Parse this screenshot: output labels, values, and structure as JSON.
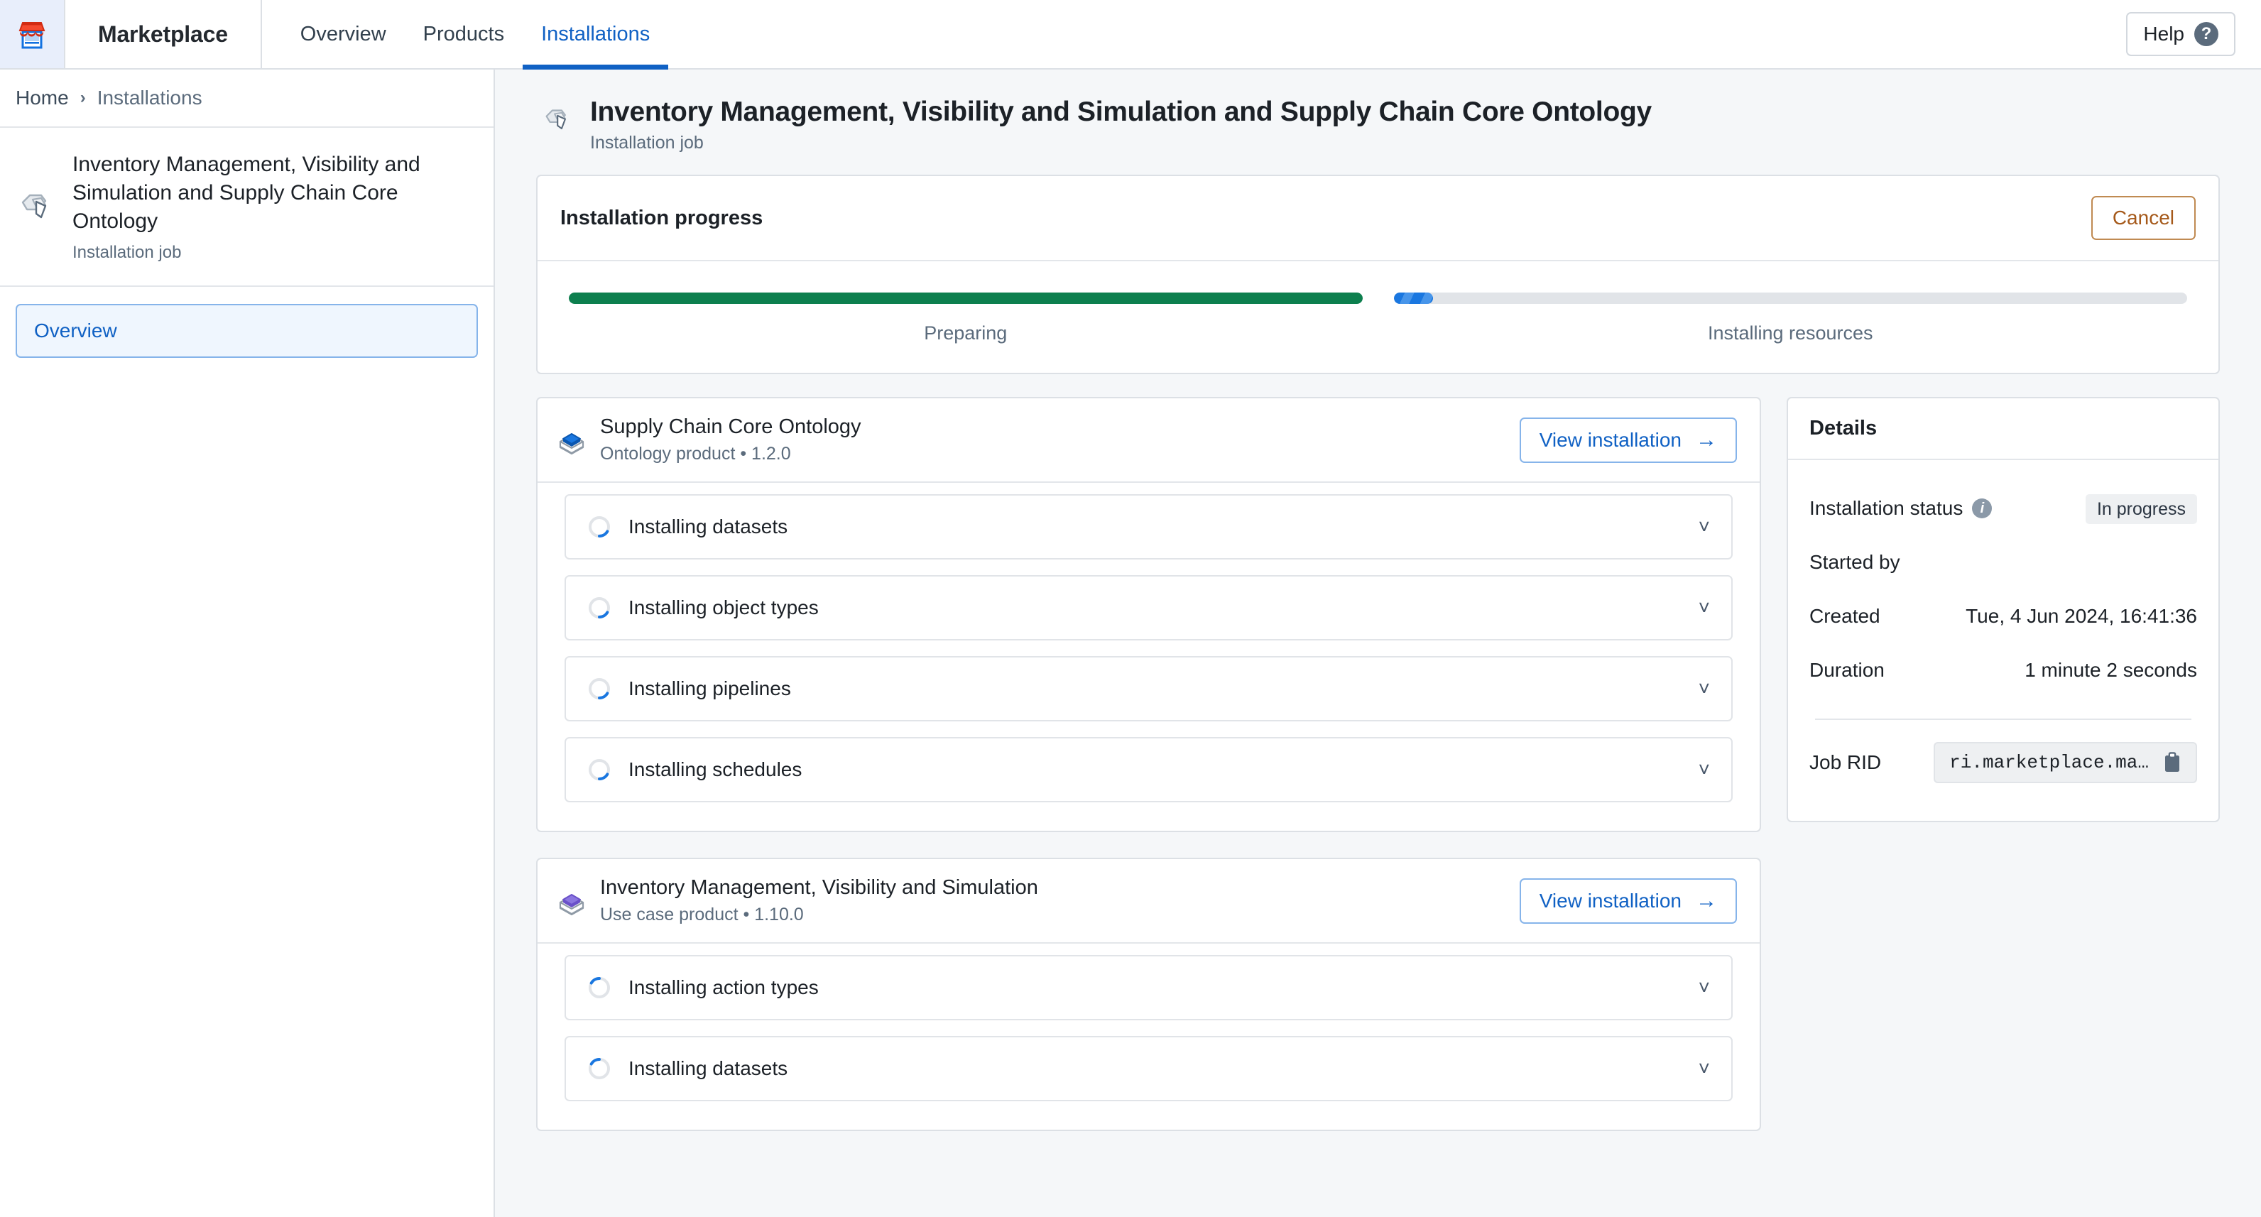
{
  "topbar": {
    "logo_icon": "marketplace-storefront-icon",
    "brand": "Marketplace",
    "tabs": [
      {
        "label": "Overview",
        "active": false
      },
      {
        "label": "Products",
        "active": false
      },
      {
        "label": "Installations",
        "active": true
      }
    ],
    "help_label": "Help",
    "help_icon": "question-circle-icon",
    "active_tab_color": "#1061c4"
  },
  "sidebar": {
    "breadcrumb": {
      "home": "Home",
      "separator": "›",
      "current": "Installations"
    },
    "job_icon": "installation-job-icon",
    "title": "Inventory Management, Visibility and Simulation and Supply Chain Core Ontology",
    "subtitle": "Installation job",
    "nav_items": [
      {
        "label": "Overview",
        "selected": true
      }
    ]
  },
  "page": {
    "icon": "installation-job-icon",
    "title": "Inventory Management, Visibility and Simulation and Supply Chain Core Ontology",
    "subtitle": "Installation job"
  },
  "progress_panel": {
    "title": "Installation progress",
    "cancel_label": "Cancel",
    "cancel_color": "#a5591a",
    "segments": [
      {
        "label": "Preparing",
        "state": "complete",
        "percent": 100,
        "color": "#0d7f4e"
      },
      {
        "label": "Installing resources",
        "state": "in-progress",
        "percent": 5,
        "color": "#1a77e0"
      }
    ]
  },
  "products": [
    {
      "icon": "ontology-product-box-icon",
      "icon_color": "#1a77e0",
      "name": "Supply Chain Core Ontology",
      "meta": "Ontology product • 1.2.0",
      "view_label": "View installation",
      "arrow_icon": "arrow-right-icon",
      "steps": [
        {
          "label": "Installing datasets",
          "status": "in-progress",
          "chevron": "chevron-down-icon"
        },
        {
          "label": "Installing object types",
          "status": "in-progress",
          "chevron": "chevron-down-icon"
        },
        {
          "label": "Installing pipelines",
          "status": "in-progress",
          "chevron": "chevron-down-icon"
        },
        {
          "label": "Installing schedules",
          "status": "in-progress",
          "chevron": "chevron-down-icon"
        }
      ]
    },
    {
      "icon": "use-case-product-box-icon",
      "icon_color": "#7b63d6",
      "name": "Inventory Management, Visibility and Simulation",
      "meta": "Use case product • 1.10.0",
      "view_label": "View installation",
      "arrow_icon": "arrow-right-icon",
      "steps": [
        {
          "label": "Installing action types",
          "status": "in-progress",
          "chevron": "chevron-down-icon"
        },
        {
          "label": "Installing datasets",
          "status": "in-progress",
          "chevron": "chevron-down-icon"
        }
      ]
    }
  ],
  "details": {
    "title": "Details",
    "status_key": "Installation status",
    "status_info_icon": "info-icon",
    "status_value": "In progress",
    "started_by_key": "Started by",
    "started_by_value": "",
    "created_key": "Created",
    "created_value": "Tue, 4 Jun 2024, 16:41:36",
    "duration_key": "Duration",
    "duration_value": "1 minute 2 seconds",
    "job_rid_key": "Job RID",
    "job_rid_value": "ri.marketplace.ma…",
    "copy_icon": "clipboard-copy-icon"
  }
}
